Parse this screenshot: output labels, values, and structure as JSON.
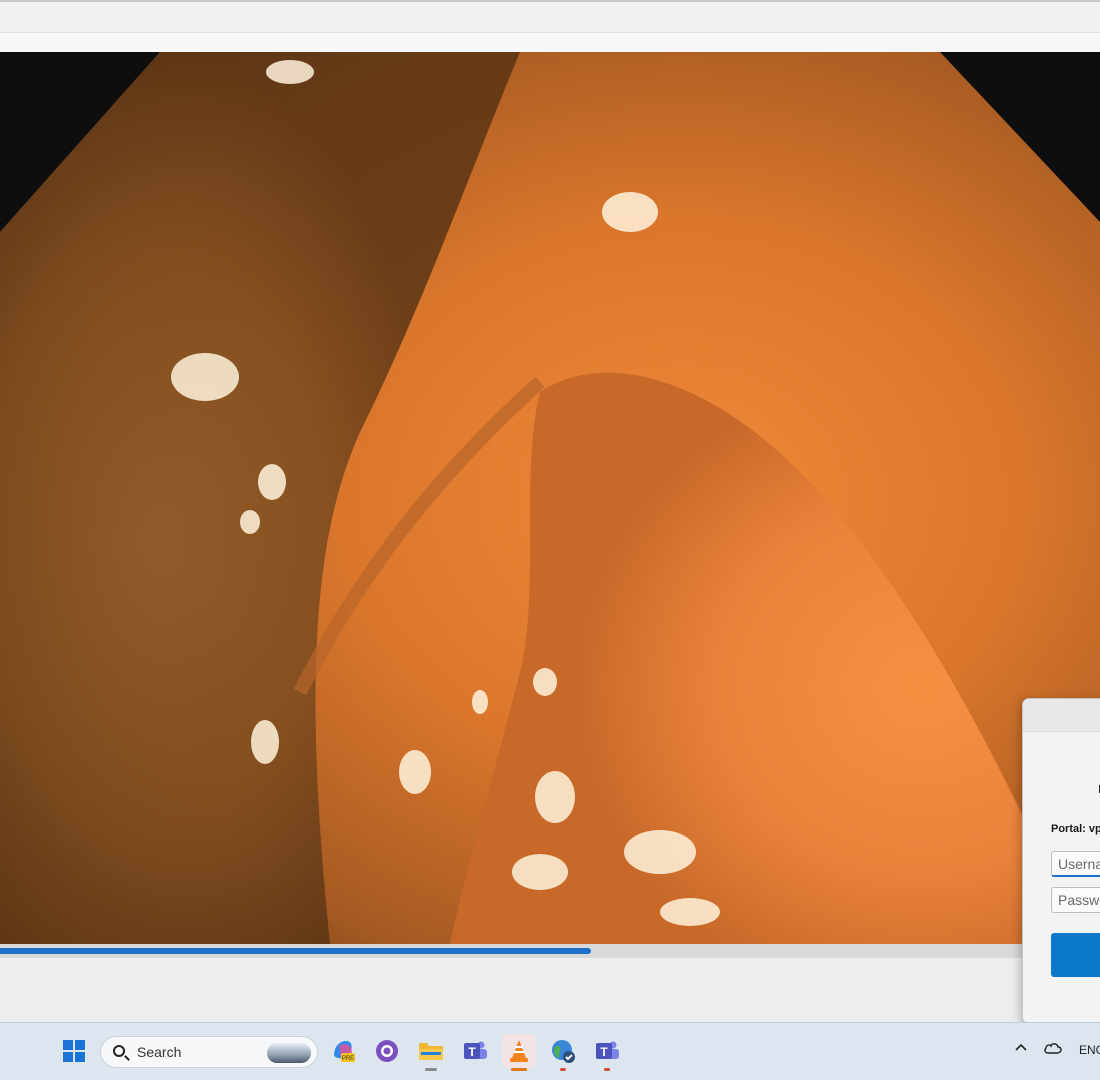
{
  "player": {
    "progress_fraction": 0.537
  },
  "login_dialog": {
    "portal_label": "Portal: vp",
    "username_placeholder": "Userna",
    "password_placeholder": "Passwo",
    "primary_button_label": ""
  },
  "taskbar": {
    "search_label": "Search",
    "apps": [
      "windows-start-icon",
      "copilot-icon",
      "github-desktop-icon",
      "file-explorer-icon",
      "teams-icon",
      "vlc-icon",
      "browser-icon",
      "teams-work-icon"
    ],
    "language": "ENG"
  },
  "colors": {
    "accent": "#0a78c8",
    "seek_fill": "#1f6fc9"
  }
}
